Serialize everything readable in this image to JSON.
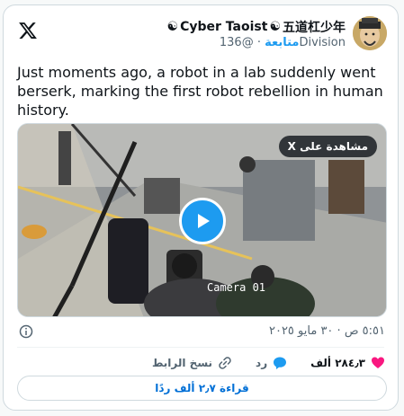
{
  "author": {
    "display_name": "Cyber Taoist",
    "name_suffix": "五道杠少年",
    "handle": "@136Division",
    "follow_label": "متابعة",
    "separator": "·"
  },
  "tweet": {
    "text": "Just moments ago, a robot in a lab suddenly went berserk, marking the first robot rebellion in human history."
  },
  "media": {
    "watch_label": "مشاهدة على X",
    "camera_label": "Camera 01"
  },
  "meta": {
    "timestamp": "٥:٥١ ص · ٣٠ مايو ٢٠٢٥"
  },
  "actions": {
    "likes": "٢٨٤٫٣ ألف",
    "reply": "رد",
    "copy_link": "نسخ الرابط"
  },
  "read_button": "قراءة ٢٫٧ ألف ردًا",
  "colors": {
    "accent": "#1d9bf0",
    "like": "#f91880",
    "text": "#0f1419",
    "muted": "#536471"
  }
}
